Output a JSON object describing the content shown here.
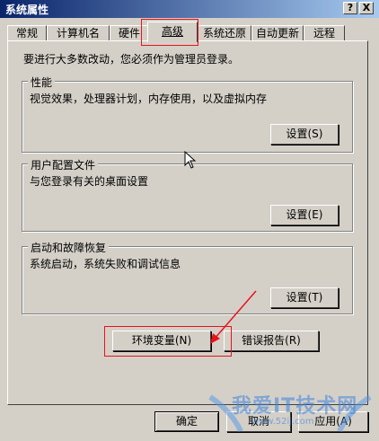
{
  "window": {
    "title": "系统属性",
    "help_btn": "?",
    "close_btn": "X"
  },
  "tabs": [
    {
      "label": "常规"
    },
    {
      "label": "计算机名"
    },
    {
      "label": "硬件"
    },
    {
      "label": "高级",
      "active": true
    },
    {
      "label": "系统还原"
    },
    {
      "label": "自动更新"
    },
    {
      "label": "远程"
    }
  ],
  "admin_note": "要进行大多数改动，您必须作为管理员登录。",
  "groups": {
    "performance": {
      "title": "性能",
      "description": "视觉效果，处理器计划，内存使用，以及虚拟内存",
      "button": "设置(S)"
    },
    "profiles": {
      "title": "用户配置文件",
      "description": "与您登录有关的桌面设置",
      "button": "设置(E)"
    },
    "startup": {
      "title": "启动和故障恢复",
      "description": "系统启动，系统失败和调试信息",
      "button": "设置(T)"
    }
  },
  "buttons": {
    "env_vars": "环境变量(N)",
    "error_report": "错误报告(R)",
    "ok": "确定",
    "cancel": "取消",
    "apply": "应用(A)"
  },
  "watermark": {
    "text": "我爱IT技术网",
    "sub": "www.52ij.com"
  },
  "colors": {
    "title_start": "#0a246a",
    "title_end": "#a6caf0",
    "face": "#d4d0c8",
    "highlight": "#e8121a"
  }
}
